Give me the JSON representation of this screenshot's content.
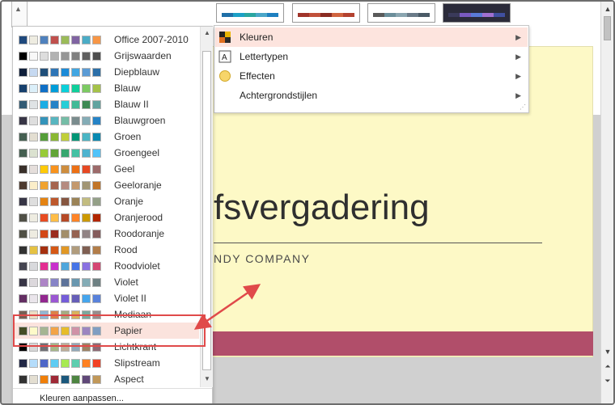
{
  "variants": [
    {
      "colors": [
        "#1f6fa7",
        "#1ba0c6",
        "#2aa6a0",
        "#4aa6c8",
        "#1d7fc0"
      ]
    },
    {
      "colors": [
        "#a0342a",
        "#c0503a",
        "#8a2b22",
        "#d0643f",
        "#b3412f"
      ]
    },
    {
      "colors": [
        "#5a5a5a",
        "#6b8e9a",
        "#8aa5b0",
        "#6a7a88",
        "#4a5a66"
      ]
    },
    {
      "colors": [
        "#3a3a5a",
        "#7a5ac0",
        "#5a7ad8",
        "#a070d0",
        "#4050a0"
      ]
    }
  ],
  "submenu": {
    "items": [
      {
        "label": "Kleuren",
        "icon": "colors-icon"
      },
      {
        "label": "Lettertypen",
        "icon": "fonts-icon"
      },
      {
        "label": "Effecten",
        "icon": "effects-icon"
      },
      {
        "label": "Achtergrondstijlen",
        "icon": "background-styles-icon"
      }
    ]
  },
  "slide": {
    "title": "fsvergadering",
    "subtitle": "NDY COMPANY"
  },
  "panel": {
    "schemes": [
      {
        "name": "Office 2007-2010",
        "colors": [
          "#1f497d",
          "#eeece1",
          "#4f81bd",
          "#c0504d",
          "#9bbb59",
          "#8064a2",
          "#4bacc6",
          "#f79646"
        ]
      },
      {
        "name": "Grijswaarden",
        "colors": [
          "#000000",
          "#f8f8f8",
          "#dddddd",
          "#b2b2b2",
          "#969696",
          "#808080",
          "#5f5f5f",
          "#4d4d4d"
        ]
      },
      {
        "name": "Diepblauw",
        "colors": [
          "#0f1f3a",
          "#c6d9f1",
          "#1f4e79",
          "#2e75b6",
          "#1b8bd8",
          "#41a6e2",
          "#5a9bd5",
          "#2c6fa8"
        ]
      },
      {
        "name": "Blauw",
        "colors": [
          "#17406d",
          "#dbeff9",
          "#0f6fc6",
          "#009dd9",
          "#0bd0d9",
          "#10cf9b",
          "#7cca62",
          "#a5c249"
        ]
      },
      {
        "name": "Blauw II",
        "colors": [
          "#335b74",
          "#dfe3e5",
          "#1cade4",
          "#2683c6",
          "#27ced7",
          "#42ba97",
          "#3e8853",
          "#62a39f"
        ]
      },
      {
        "name": "Blauwgroen",
        "colors": [
          "#373545",
          "#dedede",
          "#3494ba",
          "#58b6c0",
          "#75bda7",
          "#7a8c8e",
          "#84acb6",
          "#2683c6"
        ]
      },
      {
        "name": "Groen",
        "colors": [
          "#455f51",
          "#e3ded1",
          "#549e39",
          "#8ab833",
          "#c0cf3a",
          "#029676",
          "#4ab5c4",
          "#0989b1"
        ]
      },
      {
        "name": "Groengeel",
        "colors": [
          "#455f51",
          "#dbe2d0",
          "#99cb38",
          "#63a537",
          "#37a76f",
          "#44c1a3",
          "#4eb3cf",
          "#51c3f9"
        ]
      },
      {
        "name": "Geel",
        "colors": [
          "#39302a",
          "#e5dedb",
          "#ffca08",
          "#f8931d",
          "#ce8d3e",
          "#ec7016",
          "#e64823",
          "#9c6a6a"
        ]
      },
      {
        "name": "Geeloranje",
        "colors": [
          "#4e3b30",
          "#fbeec9",
          "#f0a22e",
          "#a5644e",
          "#b58b80",
          "#c3986d",
          "#a19574",
          "#c17529"
        ]
      },
      {
        "name": "Oranje",
        "colors": [
          "#373545",
          "#dedede",
          "#e48312",
          "#bd582c",
          "#865640",
          "#9b8357",
          "#c2bc80",
          "#94a088"
        ]
      },
      {
        "name": "Oranjerood",
        "colors": [
          "#505046",
          "#eeece1",
          "#e84c22",
          "#ffbd47",
          "#b64926",
          "#ff8427",
          "#cc9900",
          "#b22600"
        ]
      },
      {
        "name": "Roodoranje",
        "colors": [
          "#505046",
          "#eeece1",
          "#d34817",
          "#9b2d1f",
          "#a28e6a",
          "#956251",
          "#918485",
          "#855d5d"
        ]
      },
      {
        "name": "Rood",
        "colors": [
          "#323232",
          "#e5c243",
          "#a5300f",
          "#d55816",
          "#e19825",
          "#b19c7d",
          "#7f5f52",
          "#b27d49"
        ]
      },
      {
        "name": "Roodviolet",
        "colors": [
          "#454551",
          "#d8d9dc",
          "#e32d91",
          "#c830cc",
          "#4ea6dc",
          "#4775e7",
          "#8971e1",
          "#d54773"
        ]
      },
      {
        "name": "Violet",
        "colors": [
          "#373545",
          "#dcd8dc",
          "#ad84c6",
          "#8784c7",
          "#5d739a",
          "#6997af",
          "#84acb6",
          "#6f8183"
        ]
      },
      {
        "name": "Violet II",
        "colors": [
          "#632e62",
          "#eae5eb",
          "#92278f",
          "#9b57d3",
          "#755dd9",
          "#665eb8",
          "#45a5ed",
          "#5982db"
        ]
      },
      {
        "name": "Mediaan",
        "colors": [
          "#775f55",
          "#ebddc3",
          "#94b6d2",
          "#dd8047",
          "#a5ab81",
          "#d8b25c",
          "#7ba79d",
          "#968c8c"
        ]
      },
      {
        "name": "Papier",
        "colors": [
          "#444d26",
          "#fefac9",
          "#a5b592",
          "#f3a447",
          "#e7bc29",
          "#d092a7",
          "#9c85c0",
          "#809ec2"
        ]
      },
      {
        "name": "Lichtkrant",
        "colors": [
          "#000000",
          "#d8d8d8",
          "#6f6f74",
          "#a7b789",
          "#beae98",
          "#92a9b9",
          "#9c8265",
          "#8d6974"
        ]
      },
      {
        "name": "Slipstream",
        "colors": [
          "#212745",
          "#b4dcfa",
          "#4e67c8",
          "#5eccf3",
          "#a7ea52",
          "#5dceaf",
          "#ff8021",
          "#f14124"
        ]
      },
      {
        "name": "Aspect",
        "colors": [
          "#323232",
          "#e3ded1",
          "#f07f09",
          "#9f2936",
          "#1b587c",
          "#4e8542",
          "#604878",
          "#c19859"
        ]
      }
    ],
    "selected": "Papier",
    "customize_label": "Kleuren aanpassen..."
  }
}
